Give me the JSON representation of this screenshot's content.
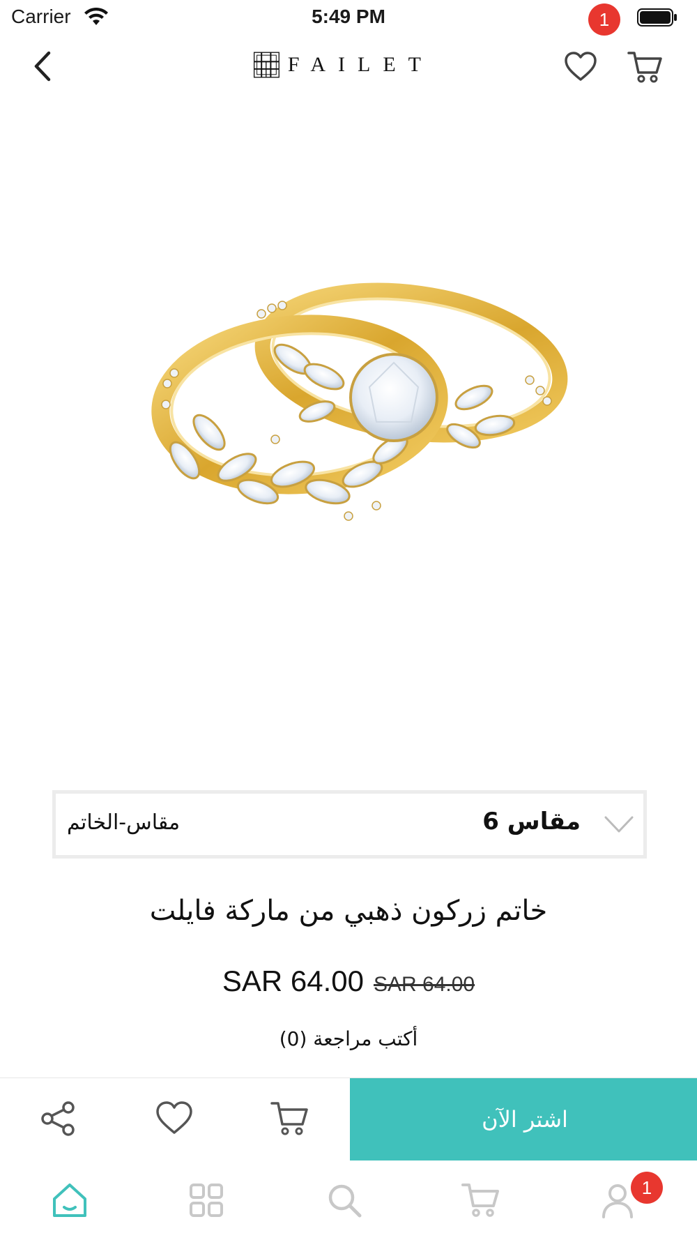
{
  "status_bar": {
    "carrier": "Carrier",
    "time": "5:49 PM"
  },
  "header": {
    "brand_name": "FAILET",
    "wishlist_count": "1"
  },
  "variant": {
    "label": "مقاس-الخاتم",
    "selected": "مقاس 6"
  },
  "product": {
    "title": "خاتم زركون ذهبي من ماركة فايلت",
    "price": "SAR 64.00",
    "original_price": "SAR 64.00",
    "review_link": "أكتب مراجعة  (0)"
  },
  "actions": {
    "buy_now": "اشتر الآن"
  },
  "tab_bar": {
    "account_badge": "1"
  },
  "colors": {
    "accent": "#40c1bb",
    "badge": "#e8372f",
    "icon_gray": "#c8c8c8",
    "icon_dark": "#555555"
  }
}
